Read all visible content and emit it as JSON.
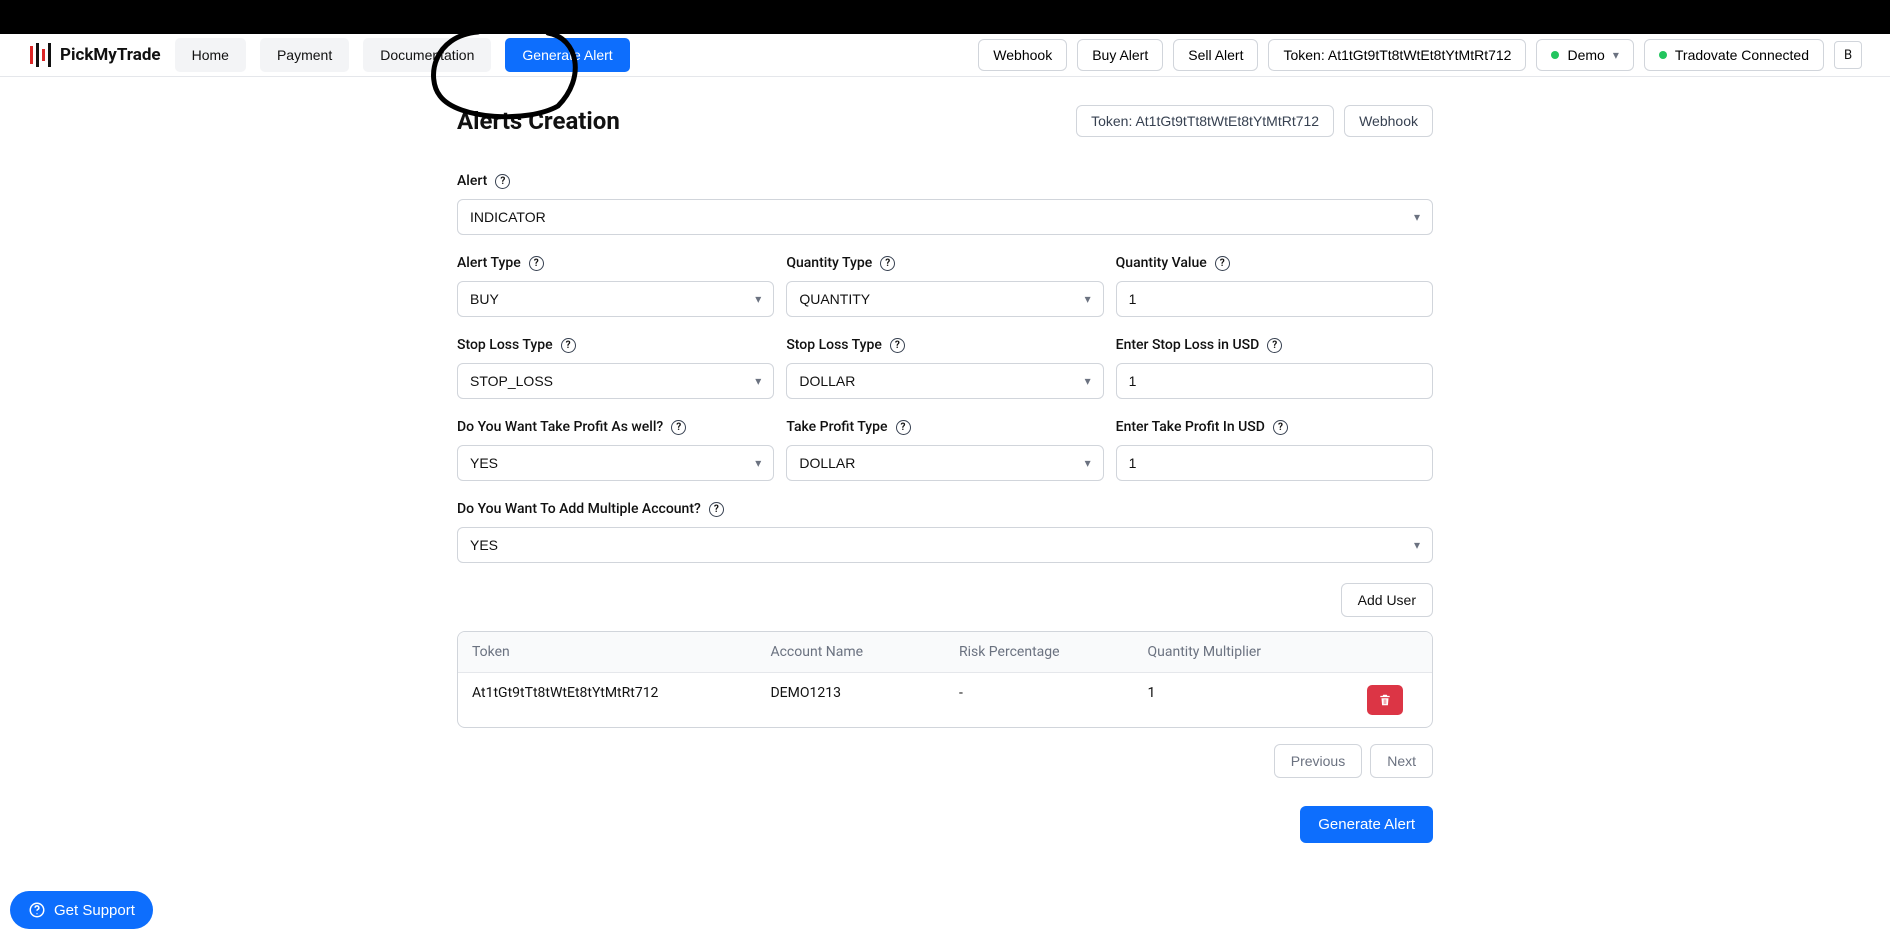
{
  "brand": {
    "name": "PickMyTrade"
  },
  "header": {
    "nav": {
      "home": "Home",
      "payment": "Payment",
      "docs": "Documentation",
      "generate": "Generate Alert"
    },
    "right": {
      "webhook": "Webhook",
      "buy_alert": "Buy Alert",
      "sell_alert": "Sell Alert",
      "token": "Token: At1tGt9tTt8tWtEt8tYtMtRt712",
      "account": "Demo",
      "conn": "Tradovate Connected",
      "avatar": "B"
    }
  },
  "page": {
    "title": "Alerts Creation",
    "badges": {
      "token": "Token: At1tGt9tTt8tWtEt8tYtMtRt712",
      "webhook": "Webhook"
    }
  },
  "form": {
    "alert": {
      "label": "Alert",
      "value": "INDICATOR"
    },
    "alert_type": {
      "label": "Alert Type",
      "value": "BUY"
    },
    "qty_type": {
      "label": "Quantity Type",
      "value": "QUANTITY"
    },
    "qty_value": {
      "label": "Quantity Value",
      "value": "1"
    },
    "sl_type1": {
      "label": "Stop Loss Type",
      "value": "STOP_LOSS"
    },
    "sl_type2": {
      "label": "Stop Loss Type",
      "value": "DOLLAR"
    },
    "sl_usd": {
      "label": "Enter Stop Loss in USD",
      "value": "1"
    },
    "tp_want": {
      "label": "Do You Want Take Profit As well?",
      "value": "YES"
    },
    "tp_type": {
      "label": "Take Profit Type",
      "value": "DOLLAR"
    },
    "tp_usd": {
      "label": "Enter Take Profit In USD",
      "value": "1"
    },
    "multi_acct": {
      "label": "Do You Want To Add Multiple Account?",
      "value": "YES"
    }
  },
  "table": {
    "headers": {
      "token": "Token",
      "account": "Account Name",
      "risk": "Risk Percentage",
      "qty_mult": "Quantity Multiplier"
    },
    "rows": [
      {
        "token": "At1tGt9tTt8tWtEt8tYtMtRt712",
        "account": "DEMO1213",
        "risk": "-",
        "qty_mult": "1"
      }
    ]
  },
  "buttons": {
    "add_user": "Add User",
    "previous": "Previous",
    "next": "Next",
    "generate_alert": "Generate Alert",
    "support": "Get Support"
  }
}
